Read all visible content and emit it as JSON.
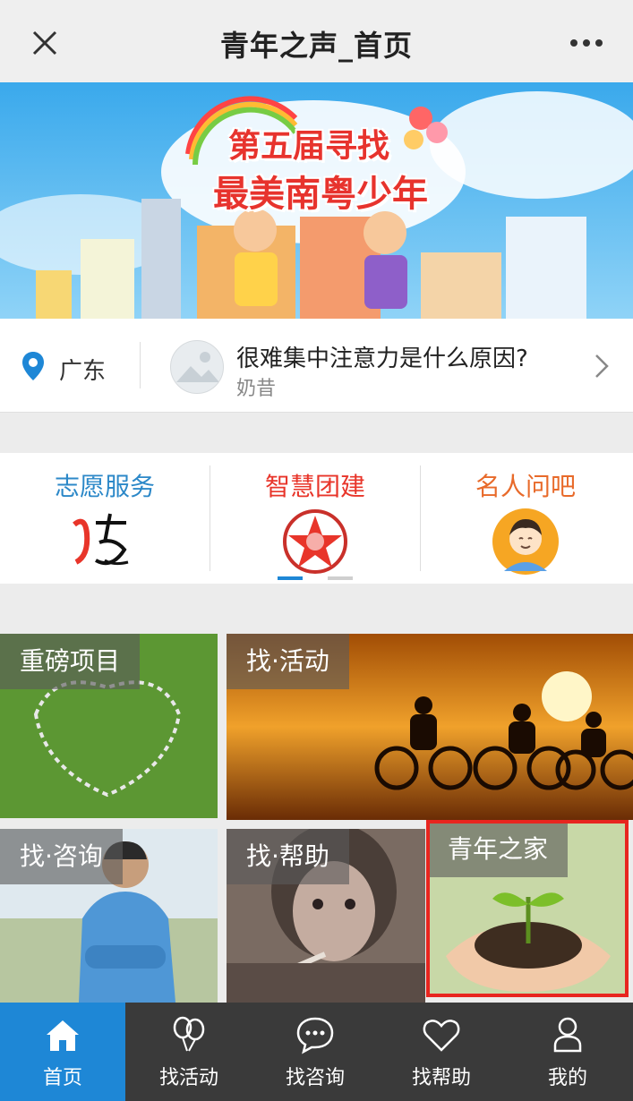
{
  "header": {
    "title": "青年之声_首页",
    "close_icon": "close-icon",
    "more_icon": "more-icon"
  },
  "banner": {
    "line1": "第五届寻找",
    "line2": "最美南粤少年"
  },
  "location_bar": {
    "city": "广东",
    "question": "很难集中注意力是什么原因?",
    "author": "奶昔",
    "pin_icon": "location-pin-icon",
    "chevron_icon": "chevron-right-icon"
  },
  "services": [
    {
      "label": "志愿服务",
      "color": "#2c88c8",
      "icon": "volunteer-logo-icon"
    },
    {
      "label": "智慧团建",
      "color": "#e8352a",
      "icon": "league-emblem-icon"
    },
    {
      "label": "名人问吧",
      "color": "#e86a2a",
      "icon": "celebrity-avatar-icon"
    }
  ],
  "carousel": {
    "active_index": 0,
    "count": 2,
    "active_color": "#1e87d6",
    "inactive_color": "#cfcfcf"
  },
  "tiles": [
    {
      "label": "重磅项目"
    },
    {
      "label": "找·活动"
    },
    {
      "label": "找·咨询"
    },
    {
      "label": "找·帮助"
    },
    {
      "label": "青年之家"
    }
  ],
  "tabbar": {
    "active_color": "#1e87d6",
    "items": [
      {
        "label": "首页",
        "icon": "home-icon"
      },
      {
        "label": "找活动",
        "icon": "balloons-icon"
      },
      {
        "label": "找咨询",
        "icon": "chat-bubble-icon"
      },
      {
        "label": "找帮助",
        "icon": "heart-icon"
      },
      {
        "label": "我的",
        "icon": "user-icon"
      }
    ]
  }
}
